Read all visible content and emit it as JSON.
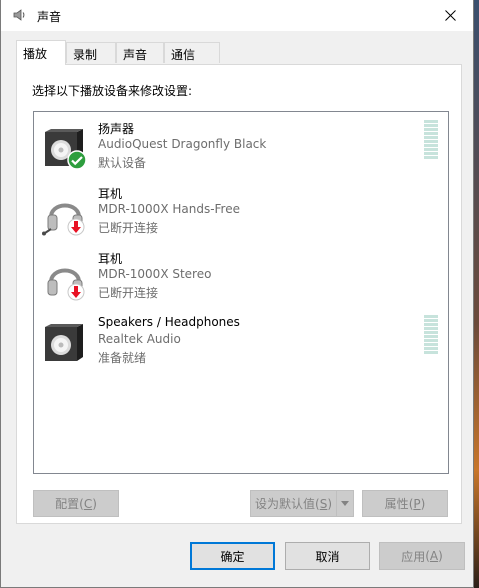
{
  "window": {
    "title": "声音"
  },
  "tabs": [
    {
      "label": "播放",
      "active": true
    },
    {
      "label": "录制",
      "active": false
    },
    {
      "label": "声音",
      "active": false
    },
    {
      "label": "通信",
      "active": false
    }
  ],
  "instruction": "选择以下播放设备来修改设置:",
  "devices": [
    {
      "name": "扬声器",
      "description": "AudioQuest Dragonfly Black",
      "status": "默认设备",
      "icon": "speaker-icon",
      "badge": "default-check-icon",
      "level_meter": true
    },
    {
      "name": "耳机",
      "description": "MDR-1000X Hands-Free",
      "status": "已断开连接",
      "icon": "headset-icon",
      "badge": "disconnected-arrow-icon",
      "level_meter": false
    },
    {
      "name": "耳机",
      "description": "MDR-1000X Stereo",
      "status": "已断开连接",
      "icon": "headphones-icon",
      "badge": "disconnected-arrow-icon",
      "level_meter": false
    },
    {
      "name": "Speakers / Headphones",
      "description": "Realtek Audio",
      "status": "准备就绪",
      "icon": "speaker-icon",
      "badge": "",
      "level_meter": true
    }
  ],
  "buttons": {
    "configure": {
      "label": "配置",
      "key": "C"
    },
    "set_default": {
      "label": "设为默认值",
      "key": "S"
    },
    "properties": {
      "label": "属性",
      "key": "P"
    },
    "ok": {
      "label": "确定"
    },
    "cancel": {
      "label": "取消"
    },
    "apply": {
      "label": "应用",
      "key": "A"
    }
  },
  "colors": {
    "accent": "#0078d7",
    "check_badge": "#2e9e3e",
    "disconnect_badge": "#e81123",
    "meter_idle": "#c7e3dc"
  }
}
